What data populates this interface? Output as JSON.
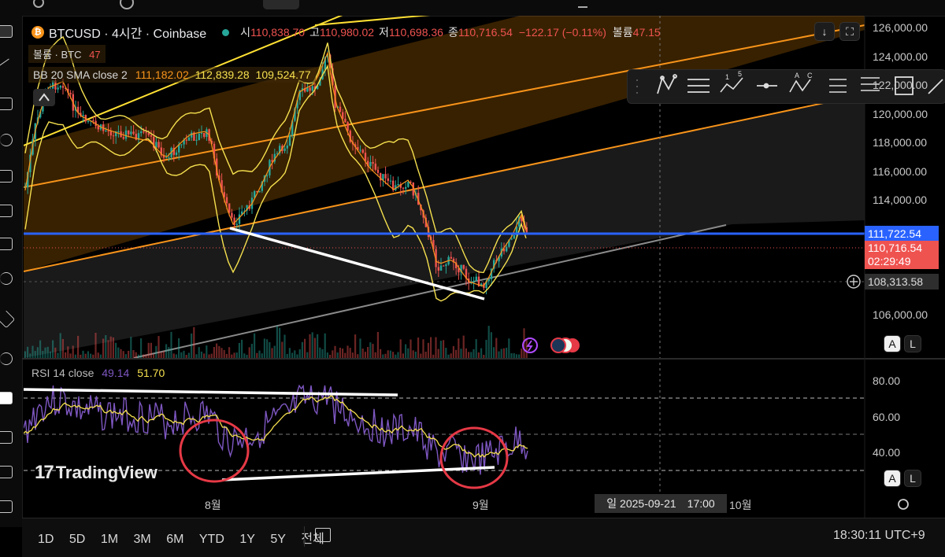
{
  "symbol": {
    "title": "BTCUSD · 4시간 · Coinbase",
    "open_label": "시",
    "open": "110,838.70",
    "high_label": "고",
    "high": "110,980.02",
    "low_label": "저",
    "low": "110,698.36",
    "close_label": "종",
    "close": "110,716.54",
    "change": "−122.17 (−0.11%)",
    "volume_label": "볼륨",
    "volume": "47.15"
  },
  "indicators": {
    "volume_legend": "볼륨 · BTC",
    "volume_value": "47",
    "bb_legend": "BB 20 SMA close 2",
    "bb_basis": "111,182.02",
    "bb_upper": "112,839.28",
    "bb_lower": "109,524.77",
    "rsi_legend": "RSI 14 close",
    "rsi_value": "49.14",
    "rsi_ma": "51.70"
  },
  "price_axis": [
    "126,000.00",
    "124,000.00",
    "122,000.00",
    "120,000.00",
    "118,000.00",
    "116,000.00",
    "114,000.00",
    "106,000.00"
  ],
  "price_tags": {
    "line": "111,722.54",
    "last": "110,716.54",
    "countdown": "02:29:49",
    "crosshair": "108,313.58"
  },
  "rsi_axis": [
    "80.00",
    "60.00",
    "40.00"
  ],
  "time_axis": {
    "aug": "8월",
    "sep": "9월",
    "oct": "10월",
    "crosshair": "일 2025-09-21",
    "crosshair_time": "17:00"
  },
  "scale_buttons": {
    "auto": "A",
    "log": "L"
  },
  "watermark": "TradingView",
  "ranges": [
    "1D",
    "5D",
    "1M",
    "3M",
    "6M",
    "YTD",
    "1Y",
    "5Y",
    "전체"
  ],
  "clock": "18:30:11 UTC+9",
  "drawing_tools": [
    "pattern-icon",
    "parallel-lines-icon",
    "elliott-wave-icon",
    "horizontal-ray-icon",
    "abcd-pattern-icon",
    "fib-retracement-icon",
    "fib-channel-icon",
    "rectangle-icon",
    "trend-line-icon"
  ],
  "colors": {
    "up": "#26a69a",
    "down": "#ef5350",
    "blue_line": "#2962ff",
    "bb": "#f5e04f",
    "rsi": "#7e57c2",
    "channel": "#f7931a"
  }
}
